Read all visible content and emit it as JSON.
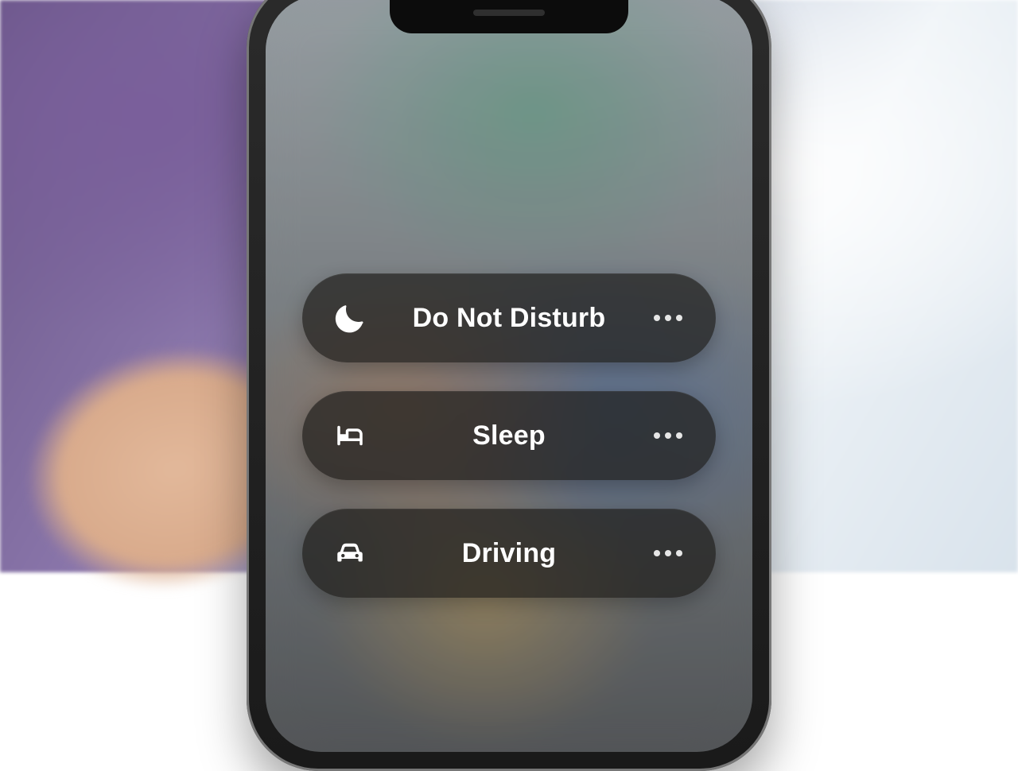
{
  "focus_modes": [
    {
      "id": "dnd",
      "label": "Do Not Disturb",
      "icon": "moon"
    },
    {
      "id": "sleep",
      "label": "Sleep",
      "icon": "bed"
    },
    {
      "id": "driving",
      "label": "Driving",
      "icon": "car"
    }
  ]
}
